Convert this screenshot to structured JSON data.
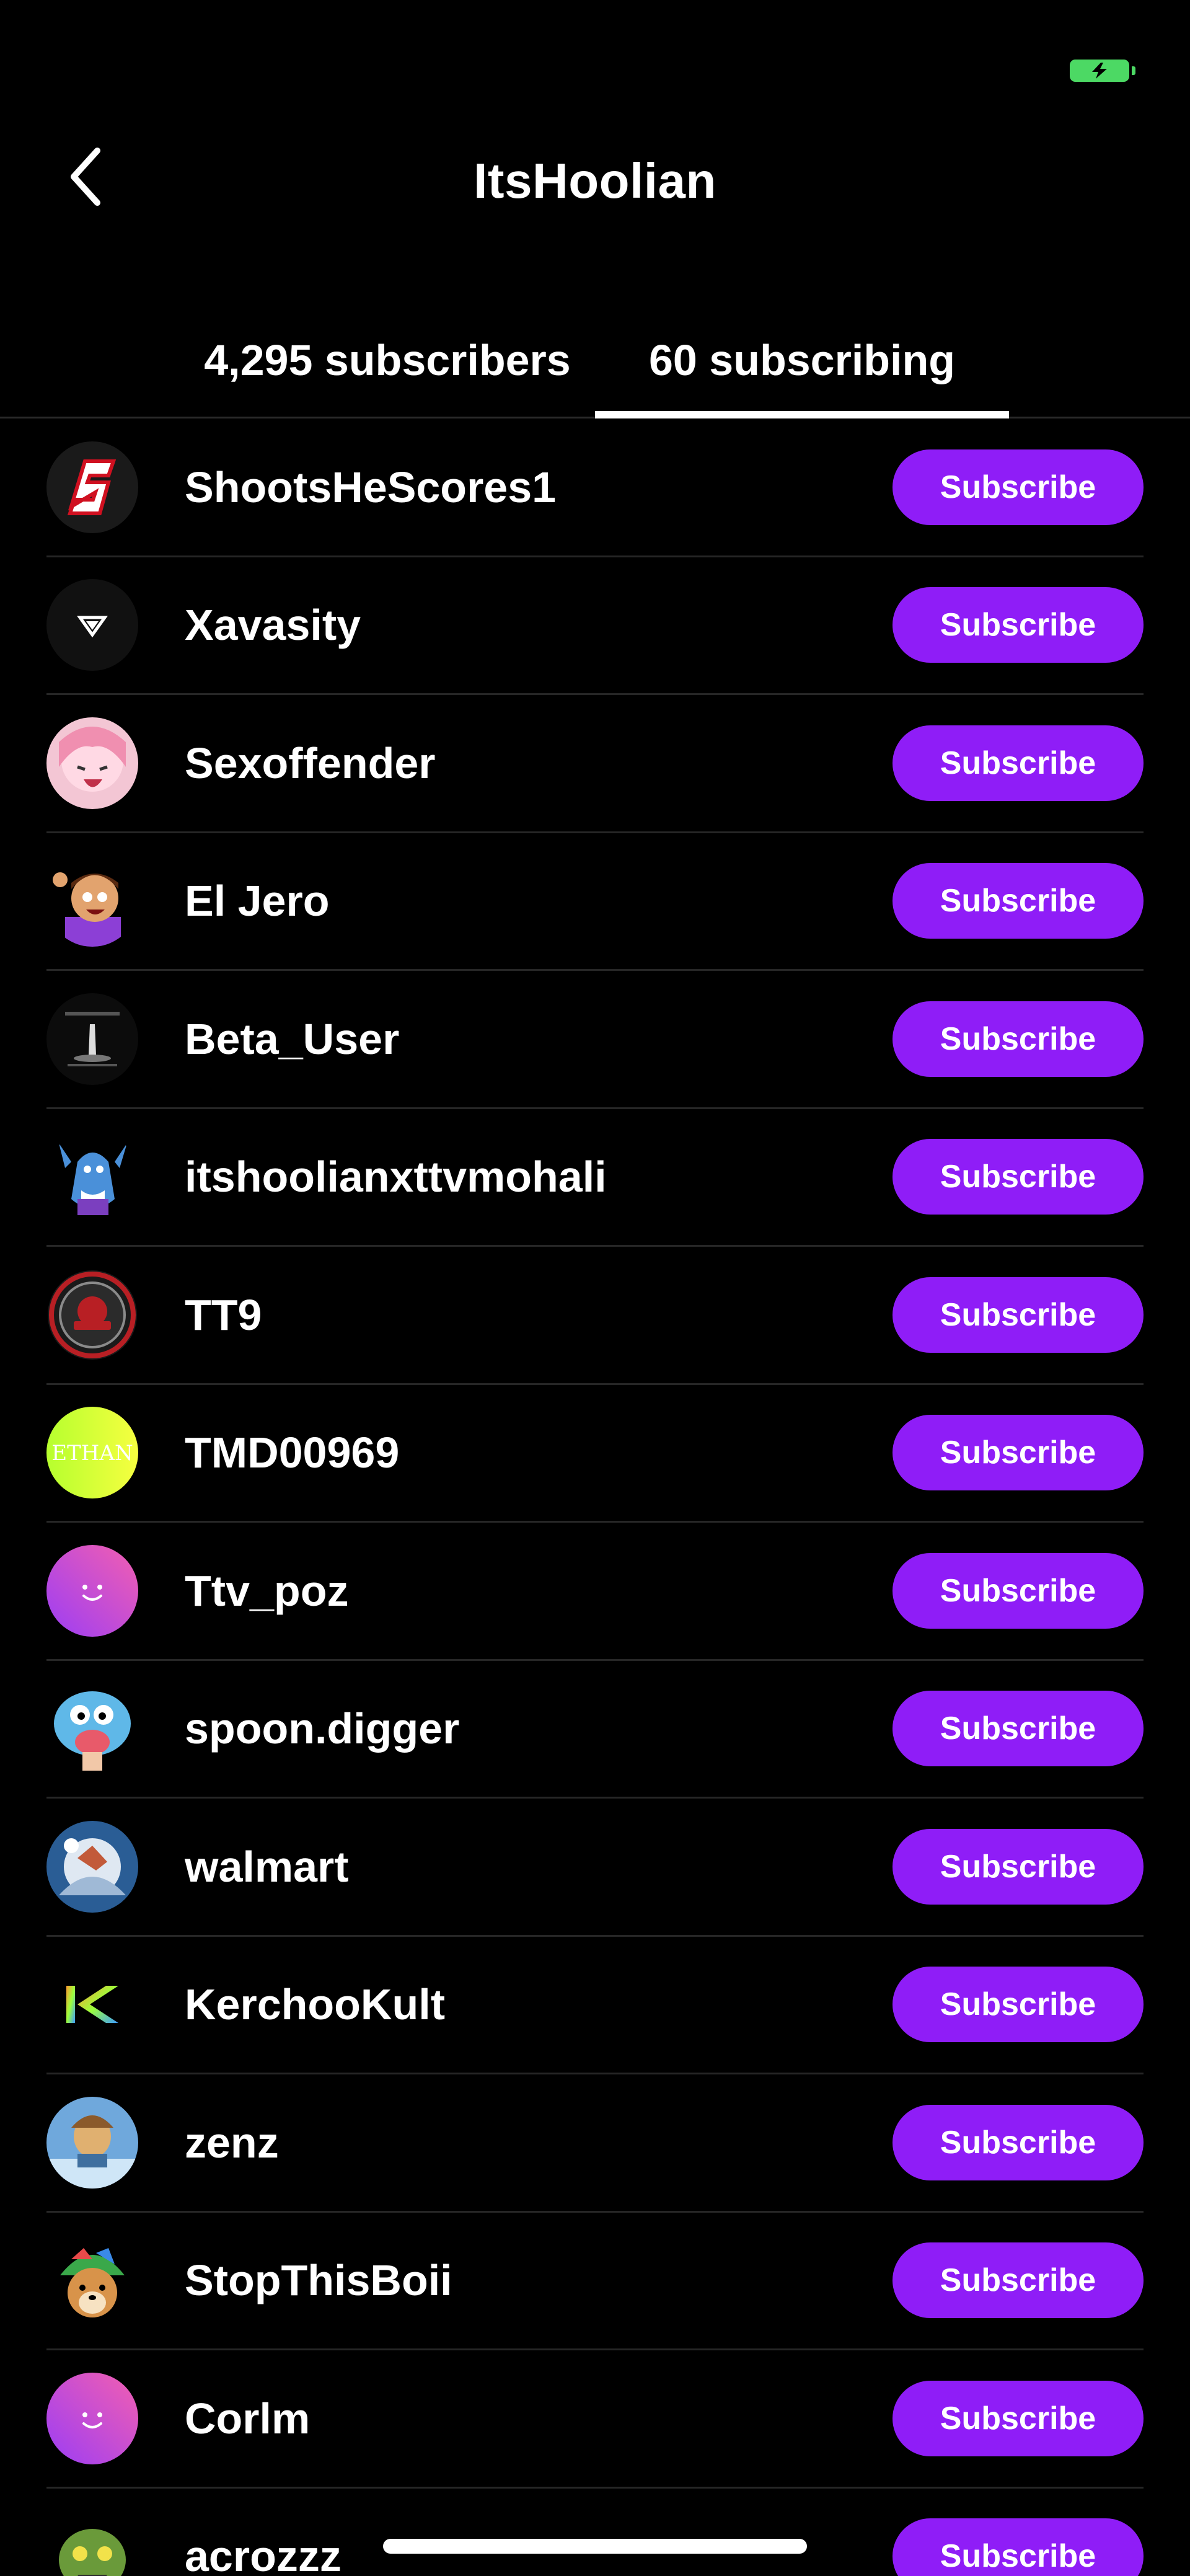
{
  "status_bar": {
    "battery_icon": "battery-charging-icon",
    "battery_color": "#4cd964"
  },
  "header": {
    "back_icon": "chevron-left-icon",
    "title": "ItsHoolian"
  },
  "tabs": [
    {
      "label": "4,295 subscribers",
      "active": false
    },
    {
      "label": "60 subscribing",
      "active": true
    }
  ],
  "colors": {
    "background": "#000000",
    "accent": "#8f1df7",
    "divider": "#262626",
    "text": "#ffffff"
  },
  "list": {
    "button_label": "Subscribe",
    "items": [
      {
        "name": "ShootsHeScores1",
        "avatar": "s-logo-avatar"
      },
      {
        "name": "Xavasity",
        "avatar": "triangle-logo-avatar"
      },
      {
        "name": "Sexoffender",
        "avatar": "anime-girl-avatar"
      },
      {
        "name": "El Jero",
        "avatar": "cartoon-boy-avatar"
      },
      {
        "name": "Beta_User",
        "avatar": "dark-landscape-avatar"
      },
      {
        "name": "itshoolianxttvmohali",
        "avatar": "cartoon-shark-avatar"
      },
      {
        "name": "TT9",
        "avatar": "red-emblem-avatar"
      },
      {
        "name": "TMD00969",
        "avatar": "ethan-gradient-avatar"
      },
      {
        "name": "Ttv_poz",
        "avatar": "default-smile-avatar"
      },
      {
        "name": "spoon.digger",
        "avatar": "blue-cat-avatar"
      },
      {
        "name": "walmart",
        "avatar": "sky-art-avatar"
      },
      {
        "name": "KerchooKult",
        "avatar": "k-logo-avatar"
      },
      {
        "name": "zenz",
        "avatar": "game-character-avatar"
      },
      {
        "name": "StopThisBoii",
        "avatar": "doge-hat-avatar"
      },
      {
        "name": "Corlm",
        "avatar": "default-smile-avatar"
      },
      {
        "name": "acrozzz",
        "avatar": "green-monster-avatar"
      }
    ]
  }
}
